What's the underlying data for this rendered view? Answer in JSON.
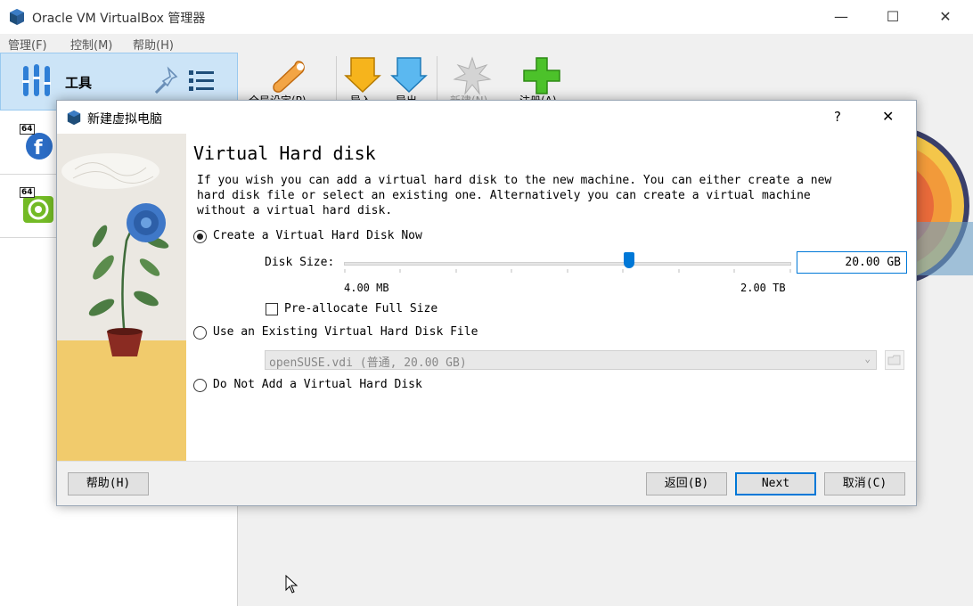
{
  "window": {
    "title": "Oracle VM VirtualBox 管理器",
    "controls": {
      "minimize": "—",
      "maximize": "☐",
      "close": "✕"
    }
  },
  "menu": [
    "管理(F)",
    "控制(M)",
    "帮助(H)"
  ],
  "sidebar": {
    "tools_label": "工具",
    "vm_badges": [
      "64",
      "64"
    ]
  },
  "toolbar": [
    "全局设定(P)",
    "导入",
    "导出",
    "新建(N)",
    "注册(A)"
  ],
  "dialog": {
    "title": "新建虚拟电脑",
    "help_glyph": "?",
    "close_glyph": "✕",
    "heading": "Virtual Hard disk",
    "description": "If you wish you can add a virtual hard disk to the new machine. You can either create a new hard disk file or select an existing one. Alternatively you can create a virtual machine without a virtual hard disk.",
    "options": {
      "create": "Create a Virtual Hard Disk Now",
      "existing": "Use an Existing Virtual Hard Disk File",
      "none": "Do Not Add a Virtual Hard Disk"
    },
    "selected_option": "create",
    "disk_size_label": "Disk Size:",
    "disk_size_value": "20.00 GB",
    "slider_min_label": "4.00 MB",
    "slider_max_label": "2.00 TB",
    "slider_fraction": 0.64,
    "preallocate_label": "Pre-allocate Full Size",
    "preallocate_checked": false,
    "existing_file": "openSUSE.vdi (普通, 20.00 GB)",
    "buttons": {
      "help": "帮助(H)",
      "back": "返回(B)",
      "next": "Next",
      "cancel": "取消(C)"
    }
  },
  "colors": {
    "accent": "#0078d7",
    "selection": "#cce4f7"
  }
}
